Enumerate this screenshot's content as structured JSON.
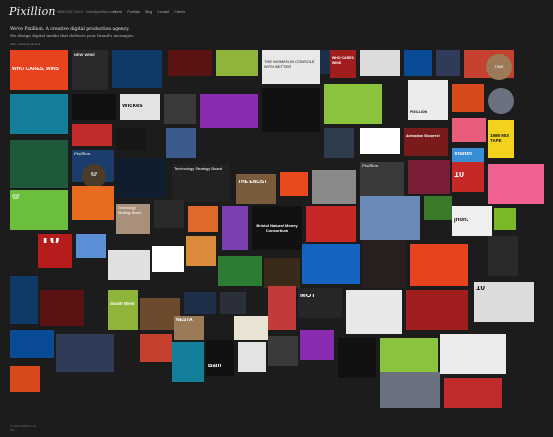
{
  "header": {
    "logo": "Pixillion",
    "contact": "0845 XXX XXXX · hello@pixillion.com",
    "nav": [
      "Home",
      "Portfolio",
      "Blog",
      "Contact",
      "Clients"
    ]
  },
  "intro": {
    "line1": "We're Pixillion. A creative digital production agency.",
    "line2": "We design digital media that delivers your brand's messages."
  },
  "filter": {
    "label": "Filter: showing all work"
  },
  "footer": {
    "line1": "© 2011 Pixillion Ltd",
    "line2": "Top"
  },
  "colors": {
    "background": "#1c1c1c",
    "text": "#dddddd"
  },
  "tiles": [
    {
      "id": "who-cares-wins",
      "text": "WHO CARES, WINS",
      "bg": "#e8431f",
      "fg": "#ffffff"
    },
    {
      "id": "new-wine",
      "text": "NEW WINE",
      "bg": "#2a2a2a",
      "fg": "#e9e9e9"
    },
    {
      "id": "blue-site",
      "text": "",
      "bg": "#0f3a68",
      "fg": "#ffffff"
    },
    {
      "id": "red-product",
      "text": "",
      "bg": "#5a1212",
      "fg": "#ffffff"
    },
    {
      "id": "green-leaf",
      "text": "",
      "bg": "#8fb43a",
      "fg": "#ffffff"
    },
    {
      "id": "woman-portrait",
      "text": "",
      "bg": "#6b4a2d",
      "fg": "#ffffff"
    },
    {
      "id": "tech-banner",
      "text": "",
      "bg": "#1e2f4a",
      "fg": "#ffffff"
    },
    {
      "id": "quote-tile",
      "text": "THE WOMEN IN CONSOLE WITH BETTER",
      "bg": "#2a2f3a",
      "fg": "#ffffff"
    },
    {
      "id": "who-cares-text",
      "text": "WHO CARES WINS",
      "bg": "#e9e3d3",
      "fg": "#1a1a1a"
    },
    {
      "id": "slide-tile",
      "text": "",
      "bg": "#c23b3b",
      "fg": "#ffffff"
    },
    {
      "id": "dark-person",
      "text": "",
      "bg": "#262626",
      "fg": "#ffffff"
    },
    {
      "id": "circle-logo",
      "text": "TIME",
      "bg": "#e8e8e8",
      "fg": "#111111"
    },
    {
      "id": "poster-tile",
      "text": "",
      "bg": "#a11e1e",
      "fg": "#ffffff"
    },
    {
      "id": "site-mockup",
      "text": "",
      "bg": "#dcdcdc",
      "fg": "#111111"
    },
    {
      "id": "wickes",
      "text": "Wickes",
      "bg": "#0a4b96",
      "fg": "#ffffff"
    },
    {
      "id": "cartoon",
      "text": "",
      "bg": "#2f3b59",
      "fg": "#ffffff"
    },
    {
      "id": "red-gadgets",
      "text": "",
      "bg": "#c6402f",
      "fg": "#ffffff"
    },
    {
      "id": "woman-sitting",
      "text": "",
      "bg": "#9b7a57",
      "fg": "#ffffff"
    },
    {
      "id": "cyan-panel",
      "text": "",
      "bg": "#137f9a",
      "fg": "#ffffff"
    },
    {
      "id": "pixillion-logo",
      "text": "PIXILLION",
      "bg": "#111111",
      "fg": "#ffffff"
    },
    {
      "id": "white-card",
      "text": "",
      "bg": "#e3e3e3",
      "fg": "#111111"
    },
    {
      "id": "badge-round",
      "text": "",
      "bg": "#3a3a3a",
      "fg": "#ffffff"
    },
    {
      "id": "animation",
      "text": "Animation Showreel",
      "bg": "#8a2bb0",
      "fg": "#ffffff"
    },
    {
      "id": "vision",
      "text": "Vision",
      "bg": "#111111",
      "fg": "#ffffff"
    },
    {
      "id": "mix-tape",
      "text": "1989 MIX TAPE",
      "bg": "#89c43c",
      "fg": "#111111"
    },
    {
      "id": "gun-icon",
      "text": "",
      "bg": "#ececec",
      "fg": "#111111"
    },
    {
      "id": "number-10-small",
      "text": "10",
      "bg": "#d84a1c",
      "fg": "#ffffff"
    },
    {
      "id": "cyclist",
      "text": "",
      "bg": "#6a7280",
      "fg": "#ffffff"
    },
    {
      "id": "red-at",
      "text": "@",
      "bg": "#c12b2b",
      "fg": "#ffffff"
    },
    {
      "id": "pixillion-small",
      "text": "Pixillion",
      "bg": "#161616",
      "fg": "#ffffff"
    },
    {
      "id": "swirl",
      "text": "",
      "bg": "#3c5a8c",
      "fg": "#ffffff"
    },
    {
      "id": "tech-board",
      "text": "Technology Strategy Board",
      "bg": "#2e3c4c",
      "fg": "#ffffff"
    },
    {
      "id": "the-enlist",
      "text": "THE ENLIST",
      "bg": "#ffffff",
      "fg": "#b31b1b"
    },
    {
      "id": "car-tile",
      "text": "",
      "bg": "#7a1b1b",
      "fg": "#ffffff"
    },
    {
      "id": "pink-card",
      "text": "",
      "bg": "#e85d7a",
      "fg": "#ffffff"
    },
    {
      "id": "yellow-square",
      "text": "",
      "bg": "#f2d21d",
      "fg": "#111111"
    },
    {
      "id": "bristol",
      "text": "Bristol Natural Money Consortium",
      "bg": "#3a8ed6",
      "fg": "#ffffff"
    },
    {
      "id": "wildlife",
      "text": "",
      "bg": "#1e5a3a",
      "fg": "#ffffff"
    },
    {
      "id": "blue-tech",
      "text": "",
      "bg": "#1b3d6b",
      "fg": "#ffffff"
    },
    {
      "id": "film-site",
      "text": "",
      "bg": "#4b3b2b",
      "fg": "#ffffff"
    },
    {
      "id": "mk-logo",
      "text": "",
      "bg": "#0e1e2e",
      "fg": "#ffffff"
    },
    {
      "id": "jhon",
      "text": "jhon.",
      "bg": "#222222",
      "fg": "#ffffff"
    },
    {
      "id": "faces",
      "text": "",
      "bg": "#7a5c3c",
      "fg": "#ffffff"
    },
    {
      "id": "at-illus",
      "text": "@",
      "bg": "#e84a1e",
      "fg": "#ffffff"
    },
    {
      "id": "dog-cartoon",
      "text": "",
      "bg": "#8a8a8a",
      "fg": "#ffffff"
    },
    {
      "id": "tech-strategy",
      "text": "Technology Strategy Board",
      "bg": "#3a3a3a",
      "fg": "#ffffff"
    },
    {
      "id": "number-10",
      "text": "10",
      "bg": "#7a1e38",
      "fg": "#ffffff"
    },
    {
      "id": "villa",
      "text": "",
      "bg": "#c62828",
      "fg": "#ffffff"
    },
    {
      "id": "pink-site",
      "text": "",
      "bg": "#f06292",
      "fg": "#ffffff"
    },
    {
      "id": "green-ad",
      "text": "",
      "bg": "#6cbf3c",
      "fg": "#ffffff"
    },
    {
      "id": "orange-site",
      "text": "",
      "bg": "#e86b1f",
      "fg": "#ffffff"
    },
    {
      "id": "kitchen",
      "text": "",
      "bg": "#a8907a",
      "fg": "#ffffff"
    },
    {
      "id": "man-portrait",
      "text": "",
      "bg": "#2a2a2a",
      "fg": "#ffffff"
    },
    {
      "id": "phone",
      "text": "",
      "bg": "#e06a2a",
      "fg": "#ffffff"
    },
    {
      "id": "paint-splash",
      "text": "10",
      "bg": "#7b3fb0",
      "fg": "#ffffff"
    },
    {
      "id": "pixillion-dark",
      "text": "Pixillion",
      "bg": "#111111",
      "fg": "#ffffff"
    },
    {
      "id": "south-west",
      "text": "South West",
      "bg": "#c62828",
      "fg": "#ffffff"
    },
    {
      "id": "map",
      "text": "",
      "bg": "#6a8ab8",
      "fg": "#ffffff"
    },
    {
      "id": "green-board",
      "text": "",
      "bg": "#3b7a2b",
      "fg": "#ffffff"
    },
    {
      "id": "mot",
      "text": "MOT",
      "bg": "#efefef",
      "fg": "#111111"
    },
    {
      "id": "green-vertical",
      "text": "",
      "bg": "#7ab82a",
      "fg": "#ffffff"
    },
    {
      "id": "red-site",
      "text": "",
      "bg": "#b71c1c",
      "fg": "#ffffff"
    },
    {
      "id": "cartoon-family",
      "text": "",
      "bg": "#5a8fd6",
      "fg": "#ffffff"
    },
    {
      "id": "nesta",
      "text": "NESTA",
      "bg": "#e0e0e0",
      "fg": "#111111"
    },
    {
      "id": "bath",
      "text": "Bath",
      "bg": "#ffffff",
      "fg": "#1a3c6c"
    },
    {
      "id": "sunset",
      "text": "",
      "bg": "#d98b3a",
      "fg": "#ffffff"
    },
    {
      "id": "flag",
      "text": "",
      "bg": "#2e7d32",
      "fg": "#ffffff"
    },
    {
      "id": "cinema",
      "text": "",
      "bg": "#3a2a1a",
      "fg": "#ffffff"
    },
    {
      "id": "blue-hd",
      "text": "",
      "bg": "#1565c0",
      "fg": "#ffffff"
    },
    {
      "id": "concert",
      "text": "",
      "bg": "#2a1f1f",
      "fg": "#ffffff"
    }
  ]
}
